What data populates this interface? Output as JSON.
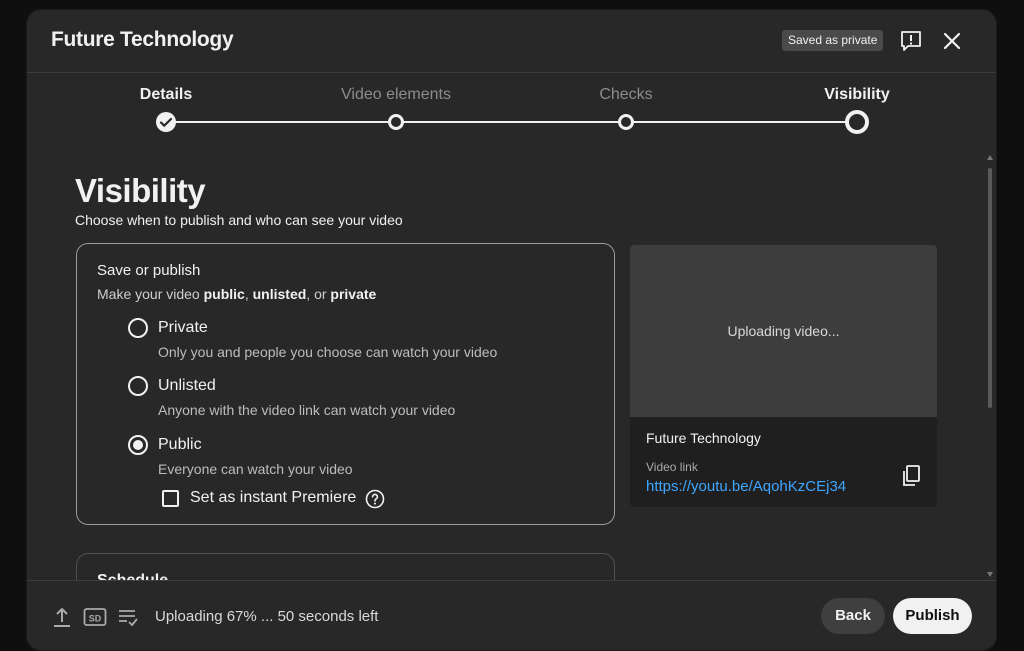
{
  "dialog": {
    "title": "Future Technology",
    "saved_badge": "Saved as private"
  },
  "stepper": {
    "steps": [
      {
        "label": "Details",
        "state": "done"
      },
      {
        "label": "Video elements",
        "state": "inactive"
      },
      {
        "label": "Checks",
        "state": "inactive"
      },
      {
        "label": "Visibility",
        "state": "current"
      }
    ]
  },
  "visibility": {
    "heading": "Visibility",
    "subtitle": "Choose when to publish and who can see your video",
    "save_card": {
      "title": "Save or publish",
      "subtitle_prefix": "Make your video ",
      "opt_public": "public",
      "sep1": ", ",
      "opt_unlisted": "unlisted",
      "sep2": ", or ",
      "opt_private": "private",
      "options": [
        {
          "label": "Private",
          "description": "Only you and people you choose can watch your video",
          "selected": false
        },
        {
          "label": "Unlisted",
          "description": "Anyone with the video link can watch your video",
          "selected": false
        },
        {
          "label": "Public",
          "description": "Everyone can watch your video",
          "selected": true
        }
      ],
      "premiere_label": "Set as instant Premiere",
      "premiere_checked": false
    },
    "schedule_title": "Schedule"
  },
  "preview": {
    "status": "Uploading video...",
    "video_title": "Future Technology",
    "link_caption": "Video link",
    "link_url": "https://youtu.be/AqohKzCEj34"
  },
  "footer": {
    "status": "Uploading 67% ... 50 seconds left",
    "upload_progress_percent": 67,
    "quality_badge": "SD",
    "back_label": "Back",
    "publish_label": "Publish"
  }
}
